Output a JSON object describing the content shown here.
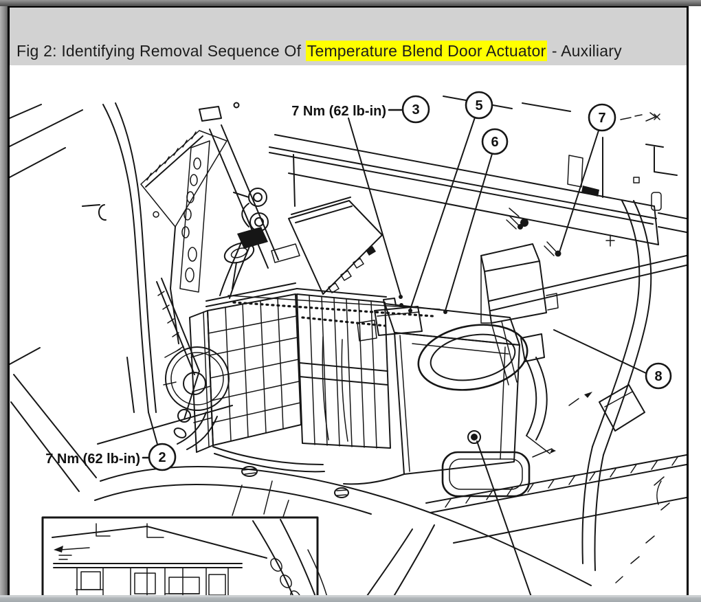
{
  "caption": {
    "prefix": "Fig 2: Identifying Removal Sequence Of ",
    "highlighted": "Temperature Blend Door Actuator",
    "suffix": " - Auxiliary",
    "highlight_color": "#ffff00",
    "band_color": "#d2d2d2",
    "text_color": "#1c1c1c"
  },
  "figure": {
    "type": "technical-line-diagram",
    "subject": "Auxiliary HVAC unit - temperature blend door actuator removal sequence",
    "line_color": "#161616",
    "background": "#ffffff",
    "torque_labels": [
      {
        "text": "7 Nm (62 lb-in)",
        "attached_callout": "3",
        "position": "top"
      },
      {
        "text": "7 Nm (62 lb-in)",
        "attached_callout": "2",
        "position": "bottom-left"
      }
    ],
    "callouts": [
      {
        "number": "2"
      },
      {
        "number": "3"
      },
      {
        "number": "5"
      },
      {
        "number": "6"
      },
      {
        "number": "7"
      },
      {
        "number": "8"
      }
    ]
  }
}
